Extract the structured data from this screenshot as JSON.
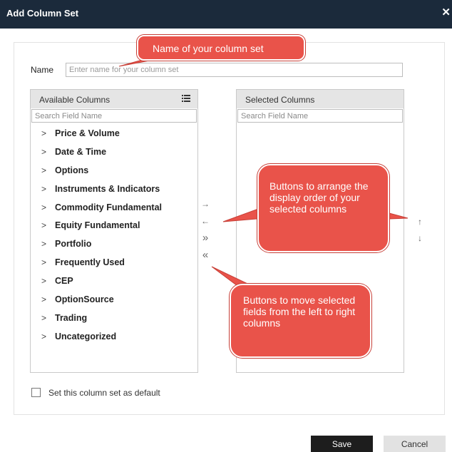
{
  "dialog": {
    "title": "Add Column Set",
    "close_glyph": "✕",
    "name_label": "Name",
    "name_placeholder": "Enter name for your column set"
  },
  "available": {
    "title": "Available Columns",
    "header_icon": "list-icon",
    "search_placeholder": "Search Field Name",
    "items": [
      {
        "label": "Price & Volume"
      },
      {
        "label": "Date & Time"
      },
      {
        "label": "Options"
      },
      {
        "label": "Instruments & Indicators"
      },
      {
        "label": "Commodity Fundamental"
      },
      {
        "label": "Equity Fundamental"
      },
      {
        "label": "Portfolio"
      },
      {
        "label": "Frequently Used"
      },
      {
        "label": "CEP"
      },
      {
        "label": "OptionSource"
      },
      {
        "label": "Trading"
      },
      {
        "label": "Uncategorized"
      }
    ]
  },
  "selected": {
    "title": "Selected Columns",
    "search_placeholder": "Search Field Name"
  },
  "transfer_buttons": {
    "add": "→",
    "remove": "←",
    "add_all": "»",
    "remove_all": "«"
  },
  "order_buttons": {
    "up": "↑",
    "down": "↓"
  },
  "footer": {
    "default_label": "Set this column set as default",
    "save_label": "Save",
    "cancel_label": "Cancel"
  },
  "annotations": {
    "name_callout": "Name of your column set",
    "order_callout": "Buttons to arrange the display order of your selected columns",
    "move_callout": "Buttons to move selected fields from the left to right columns"
  },
  "colors": {
    "titlebar": "#1b2a3b",
    "callout": "#e9534a",
    "save_button": "#1d1d1d",
    "panel_header": "#e5e5e5"
  }
}
